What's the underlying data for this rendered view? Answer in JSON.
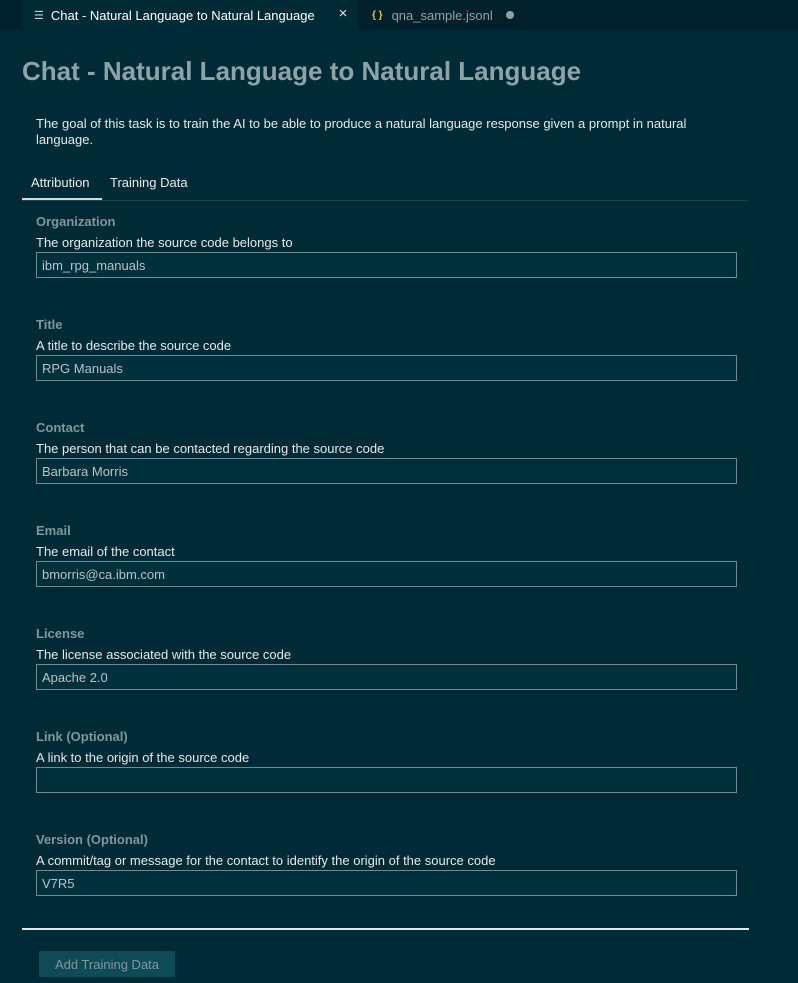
{
  "tabs": [
    {
      "label": "Chat - Natural Language to Natural Language",
      "icon": "list-icon",
      "active": true
    },
    {
      "label": "qna_sample.jsonl",
      "icon": "json-braces-icon",
      "modified": true
    }
  ],
  "page": {
    "title": "Chat - Natural Language to Natural Language",
    "description": "The goal of this task is to train the AI to be able to produce a natural language response given a prompt in natural language."
  },
  "subtabs": [
    {
      "label": "Attribution",
      "active": true
    },
    {
      "label": "Training Data",
      "active": false
    }
  ],
  "fields": [
    {
      "label": "Organization",
      "description": "The organization the source code belongs to",
      "value": "ibm_rpg_manuals"
    },
    {
      "label": "Title",
      "description": "A title to describe the source code",
      "value": "RPG Manuals"
    },
    {
      "label": "Contact",
      "description": "The person that can be contacted regarding the source code",
      "value": "Barbara Morris"
    },
    {
      "label": "Email",
      "description": "The email of the contact",
      "value": "bmorris@ca.ibm.com"
    },
    {
      "label": "License",
      "description": "The license associated with the source code",
      "value": "Apache 2.0"
    },
    {
      "label": "Link (Optional)",
      "description": "A link to the origin of the source code",
      "value": ""
    },
    {
      "label": "Version (Optional)",
      "description": "A commit/tag or message for the contact to identify the origin of the source code",
      "value": "V7R5"
    }
  ],
  "actions": {
    "add_training_data": "Add Training Data"
  },
  "colors": {
    "background": "#002b36",
    "tabbar": "#00212b",
    "label": "#7f989d",
    "button": "#0f4a57"
  }
}
